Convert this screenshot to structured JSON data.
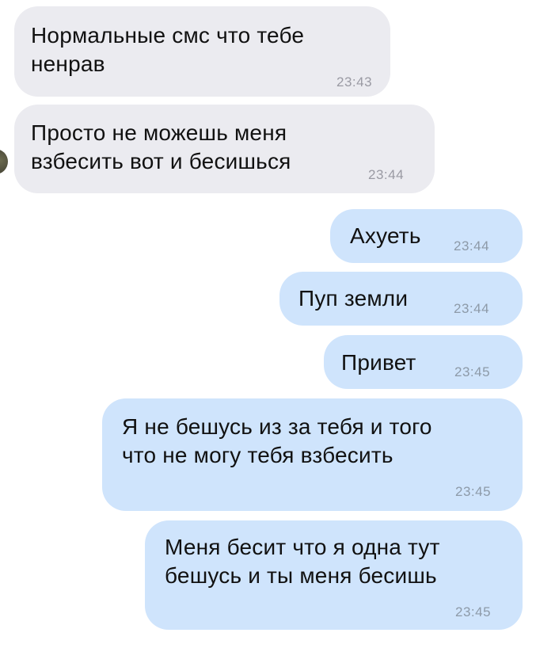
{
  "messages": [
    {
      "direction": "incoming",
      "text": "Нормальные смс что тебе\nненрав",
      "time": "23:43"
    },
    {
      "direction": "incoming",
      "text": "Просто не можешь меня\nвзбесить вот и бесишься",
      "time": "23:44"
    },
    {
      "direction": "outgoing",
      "text": "Ахуеть",
      "time": "23:44"
    },
    {
      "direction": "outgoing",
      "text": "Пуп земли",
      "time": "23:44"
    },
    {
      "direction": "outgoing",
      "text": "Привет",
      "time": "23:45"
    },
    {
      "direction": "outgoing",
      "text": "Я не бешусь из за тебя и того\nчто не могу тебя взбесить",
      "time": "23:45"
    },
    {
      "direction": "outgoing",
      "text": "Меня бесит что я одна тут\nбешусь и ты меня бесишь",
      "time": "23:45"
    }
  ],
  "colors": {
    "incoming_bubble": "#ebebf0",
    "outgoing_bubble": "#cfe4fc",
    "text": "#111111",
    "time": "#8d9aa8"
  },
  "icons": {
    "avatar": "contact-avatar"
  }
}
